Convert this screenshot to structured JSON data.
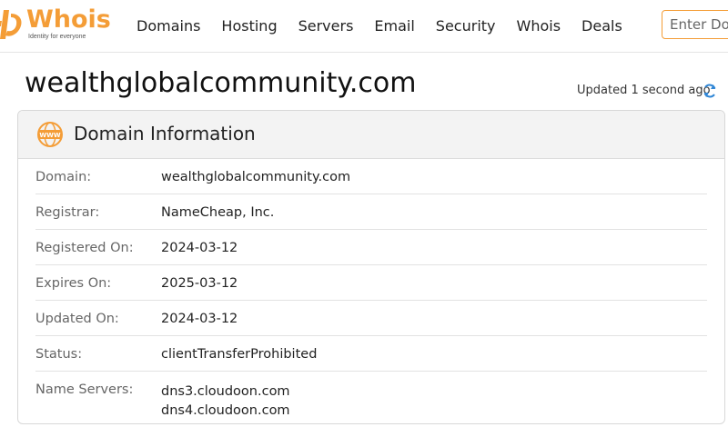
{
  "brand": {
    "name": "Whois",
    "tagline": "Identity for everyone",
    "accent": "#f49d37"
  },
  "nav": {
    "items": [
      "Domains",
      "Hosting",
      "Servers",
      "Email",
      "Security",
      "Whois",
      "Deals"
    ]
  },
  "search": {
    "placeholder": "Enter Domain"
  },
  "page": {
    "domain": "wealthglobalcommunity.com",
    "updated": "Updated 1 second ago"
  },
  "card": {
    "title": "Domain Information",
    "icon": "www-icon",
    "rows": [
      {
        "label": "Domain:",
        "values": [
          "wealthglobalcommunity.com"
        ]
      },
      {
        "label": "Registrar:",
        "values": [
          "NameCheap, Inc."
        ]
      },
      {
        "label": "Registered On:",
        "values": [
          "2024-03-12"
        ]
      },
      {
        "label": "Expires On:",
        "values": [
          "2025-03-12"
        ]
      },
      {
        "label": "Updated On:",
        "values": [
          "2024-03-12"
        ]
      },
      {
        "label": "Status:",
        "values": [
          "clientTransferProhibited"
        ]
      },
      {
        "label": "Name Servers:",
        "values": [
          "dns3.cloudoon.com",
          "dns4.cloudoon.com"
        ]
      }
    ]
  }
}
